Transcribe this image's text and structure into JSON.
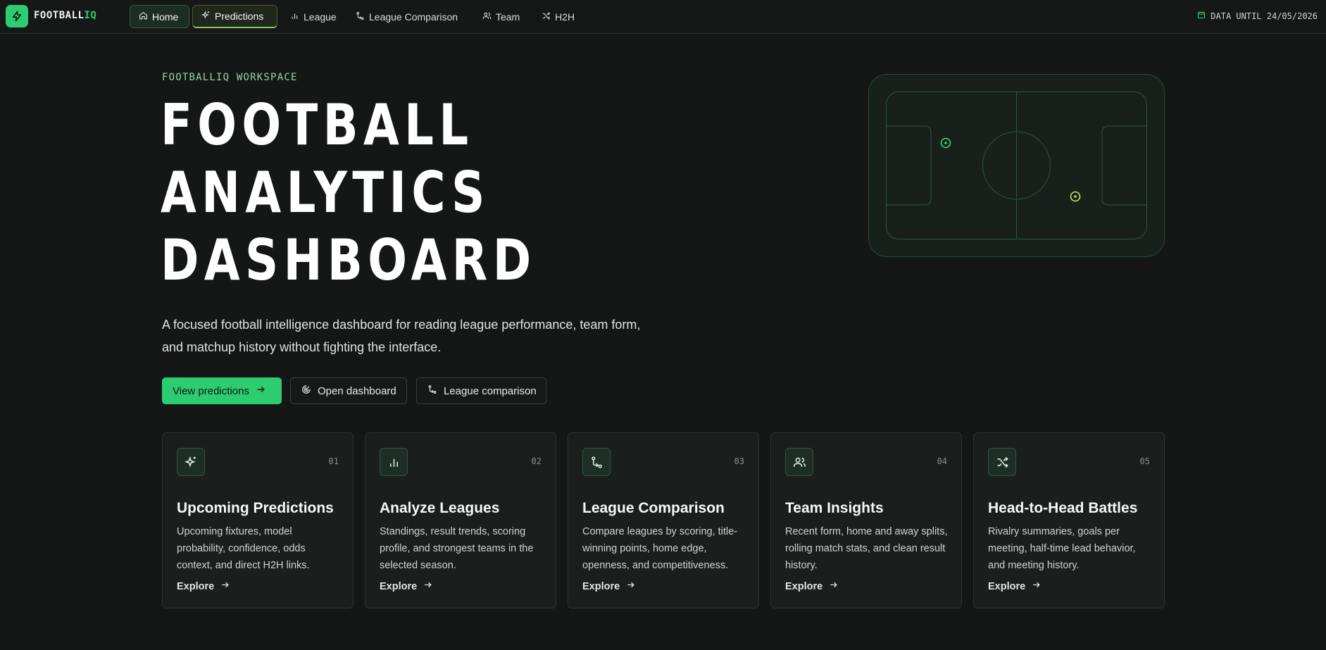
{
  "brand": {
    "name_main": "FOOTBALL",
    "name_accent": "IQ",
    "icon": "bolt-icon",
    "accent_color": "#2ecc71"
  },
  "nav": {
    "items": [
      {
        "label": "Home",
        "icon": "home-icon"
      },
      {
        "label": "Predictions",
        "icon": "sparkles-icon"
      },
      {
        "label": "League",
        "icon": "bar-chart-icon"
      },
      {
        "label": "League Comparison",
        "icon": "compare-icon"
      },
      {
        "label": "Team",
        "icon": "users-icon"
      },
      {
        "label": "H2H",
        "icon": "shuffle-icon"
      }
    ],
    "data_until": "DATA UNTIL 24/05/2026"
  },
  "hero": {
    "kicker": "FOOTBALLIQ WORKSPACE",
    "title_lines": [
      "FOOTBALL",
      "ANALYTICS",
      "DASHBOARD"
    ],
    "description": "A focused football intelligence dashboard for reading league performance, team form, and matchup history without fighting the interface.",
    "buttons": [
      {
        "label": "View predictions",
        "icon": "arrow-right-icon"
      },
      {
        "label": "Open dashboard",
        "icon": "radar-icon"
      },
      {
        "label": "League comparison",
        "icon": "compare-icon"
      }
    ]
  },
  "cards": [
    {
      "num": "01",
      "title": "Upcoming Predictions",
      "description": "Upcoming fixtures, model probability, confidence, odds context, and direct H2H links.",
      "link": "Explore",
      "icon": "sparkles-icon"
    },
    {
      "num": "02",
      "title": "Analyze Leagues",
      "description": "Standings, result trends, scoring profile, and strongest teams in the selected season.",
      "link": "Explore",
      "icon": "bar-chart-icon"
    },
    {
      "num": "03",
      "title": "League Comparison",
      "description": "Compare leagues by scoring, title-winning points, home edge, openness, and competitiveness.",
      "link": "Explore",
      "icon": "compare-icon"
    },
    {
      "num": "04",
      "title": "Team Insights",
      "description": "Recent form, home and away splits, rolling match stats, and clean result history.",
      "link": "Explore",
      "icon": "users-icon"
    },
    {
      "num": "05",
      "title": "Head-to-Head Battles",
      "description": "Rivalry summaries, goals per meeting, half-time lead behavior, and meeting history.",
      "link": "Explore",
      "icon": "shuffle-icon"
    }
  ]
}
